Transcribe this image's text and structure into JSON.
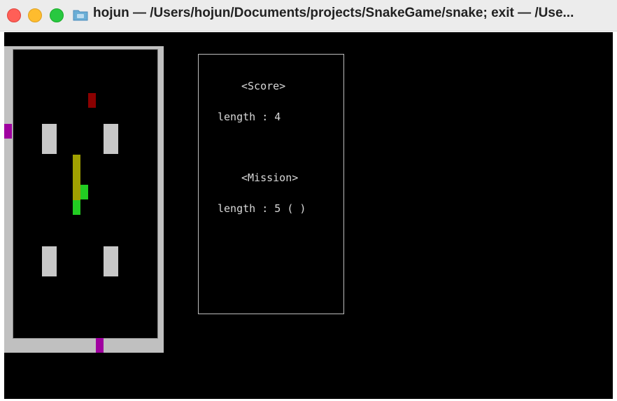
{
  "window": {
    "title": "hojun — /Users/hojun/Documents/projects/SnakeGame/snake; exit — /Use..."
  },
  "icons": {
    "close": "close-button",
    "minimize": "minimize-button",
    "maximize": "maximize-button",
    "folder": "folder-icon"
  },
  "colors": {
    "wall": "#c8c8c8",
    "gate": "#a000a0",
    "poison_item": "#8b0000",
    "snake_body": "#a0a000",
    "snake_head": "#22cc22",
    "background": "#000000"
  },
  "score": {
    "heading": "<Score>",
    "length_line": "length : 4"
  },
  "mission": {
    "heading": "<Mission>",
    "length_line": "length : 5 ( )"
  }
}
